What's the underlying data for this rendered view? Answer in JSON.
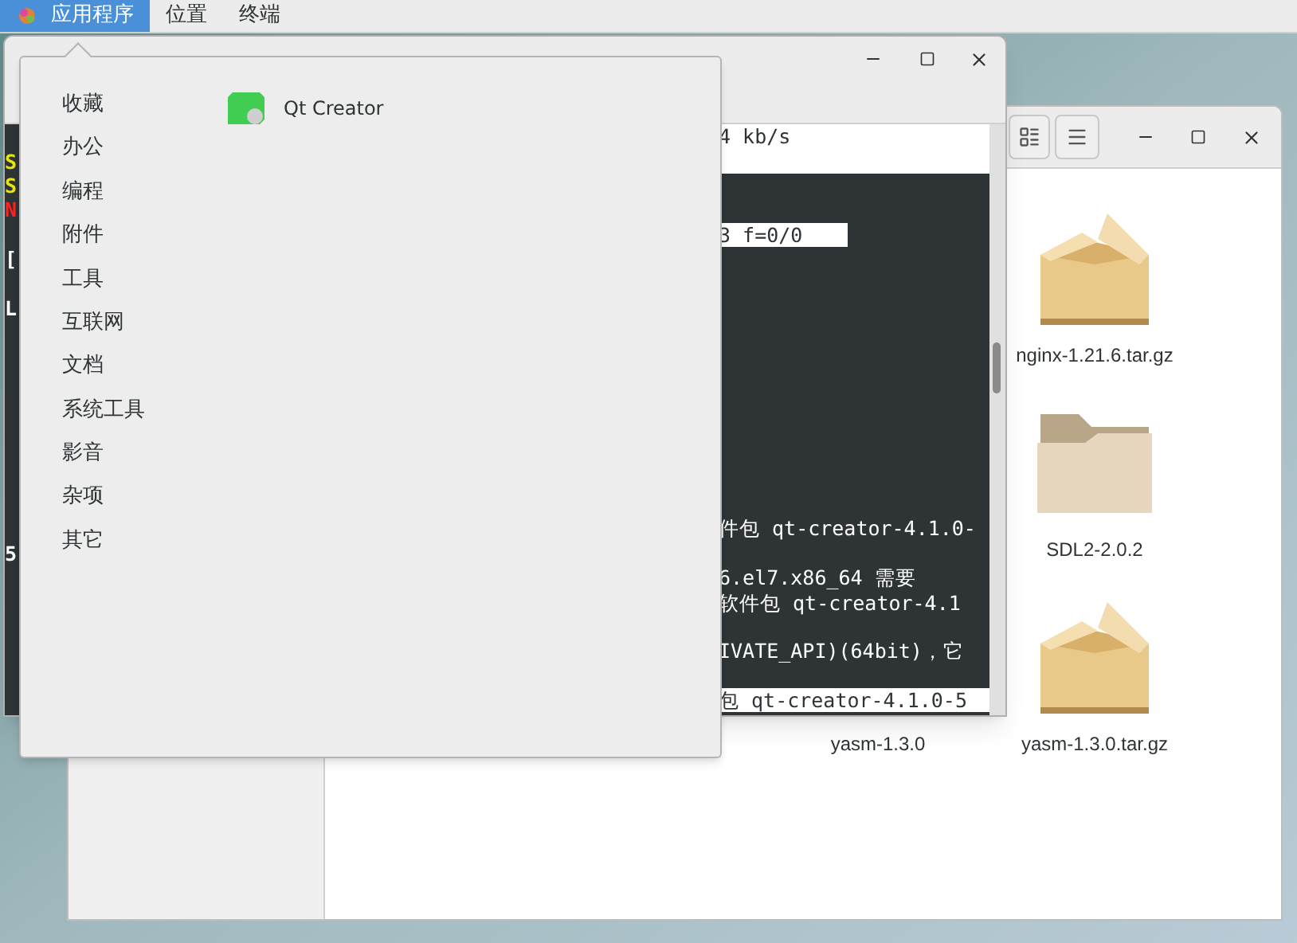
{
  "top_bar": {
    "menus": [
      {
        "label": "应用程序",
        "selected": true
      },
      {
        "label": "位置",
        "selected": false
      },
      {
        "label": "终端",
        "selected": false
      }
    ]
  },
  "terminal": {
    "lines": [
      {
        "kind": "bar",
        "text": "4 kb/s"
      },
      {
        "kind": "bar",
        "prefix": {
          "text": "S",
          "color": "#e5e510"
        }
      },
      {
        "kind": "blank",
        "prefix": {
          "text": "S",
          "color": "#e5e510"
        }
      },
      {
        "kind": "blank",
        "prefix": {
          "text": "N",
          "color": "#ff2020"
        }
      },
      {
        "kind": "highlight",
        "text": "3 f=0/0"
      },
      {
        "kind": "blank",
        "prefix": {
          "text": "[",
          "color": "#ffffff"
        }
      },
      {
        "kind": "blank"
      },
      {
        "kind": "blank",
        "prefix": {
          "text": "L",
          "color": "#ffffff"
        }
      },
      {
        "kind": "blank"
      },
      {
        "kind": "blank"
      },
      {
        "kind": "blank"
      },
      {
        "kind": "blank"
      },
      {
        "kind": "blank"
      },
      {
        "kind": "blank"
      },
      {
        "kind": "blank"
      },
      {
        "kind": "blank"
      },
      {
        "kind": "plain",
        "text": "件包 qt-creator-4.1.0-"
      },
      {
        "kind": "blank",
        "prefix": {
          "text": "5",
          "color": "#ffffff"
        }
      },
      {
        "kind": "plain",
        "text": "6.el7.x86_64 需要"
      },
      {
        "kind": "plain",
        "text": "软件包 qt-creator-4.1"
      },
      {
        "kind": "blank"
      },
      {
        "kind": "plain",
        "text": "IVATE_API)(64bit)，它"
      },
      {
        "kind": "blank"
      },
      {
        "kind": "bar",
        "text": "包 qt-creator-4.1.0-5"
      }
    ]
  },
  "file_manager": {
    "files": [
      {
        "kind": "archive",
        "name": "nginx-1.21.6.tar.gz"
      },
      {
        "kind": "folder",
        "name": "SDL2-2.0.2"
      },
      {
        "kind": "label_only",
        "name": "yasm-1.3.0"
      },
      {
        "kind": "archive",
        "name": "yasm-1.3.0.tar.gz"
      }
    ]
  },
  "applications_menu": {
    "categories": [
      "收藏",
      "办公",
      "编程",
      "附件",
      "工具",
      "互联网",
      "文档",
      "系统工具",
      "影音",
      "杂项",
      "其它"
    ],
    "apps": [
      {
        "name": "Qt Creator"
      }
    ]
  }
}
